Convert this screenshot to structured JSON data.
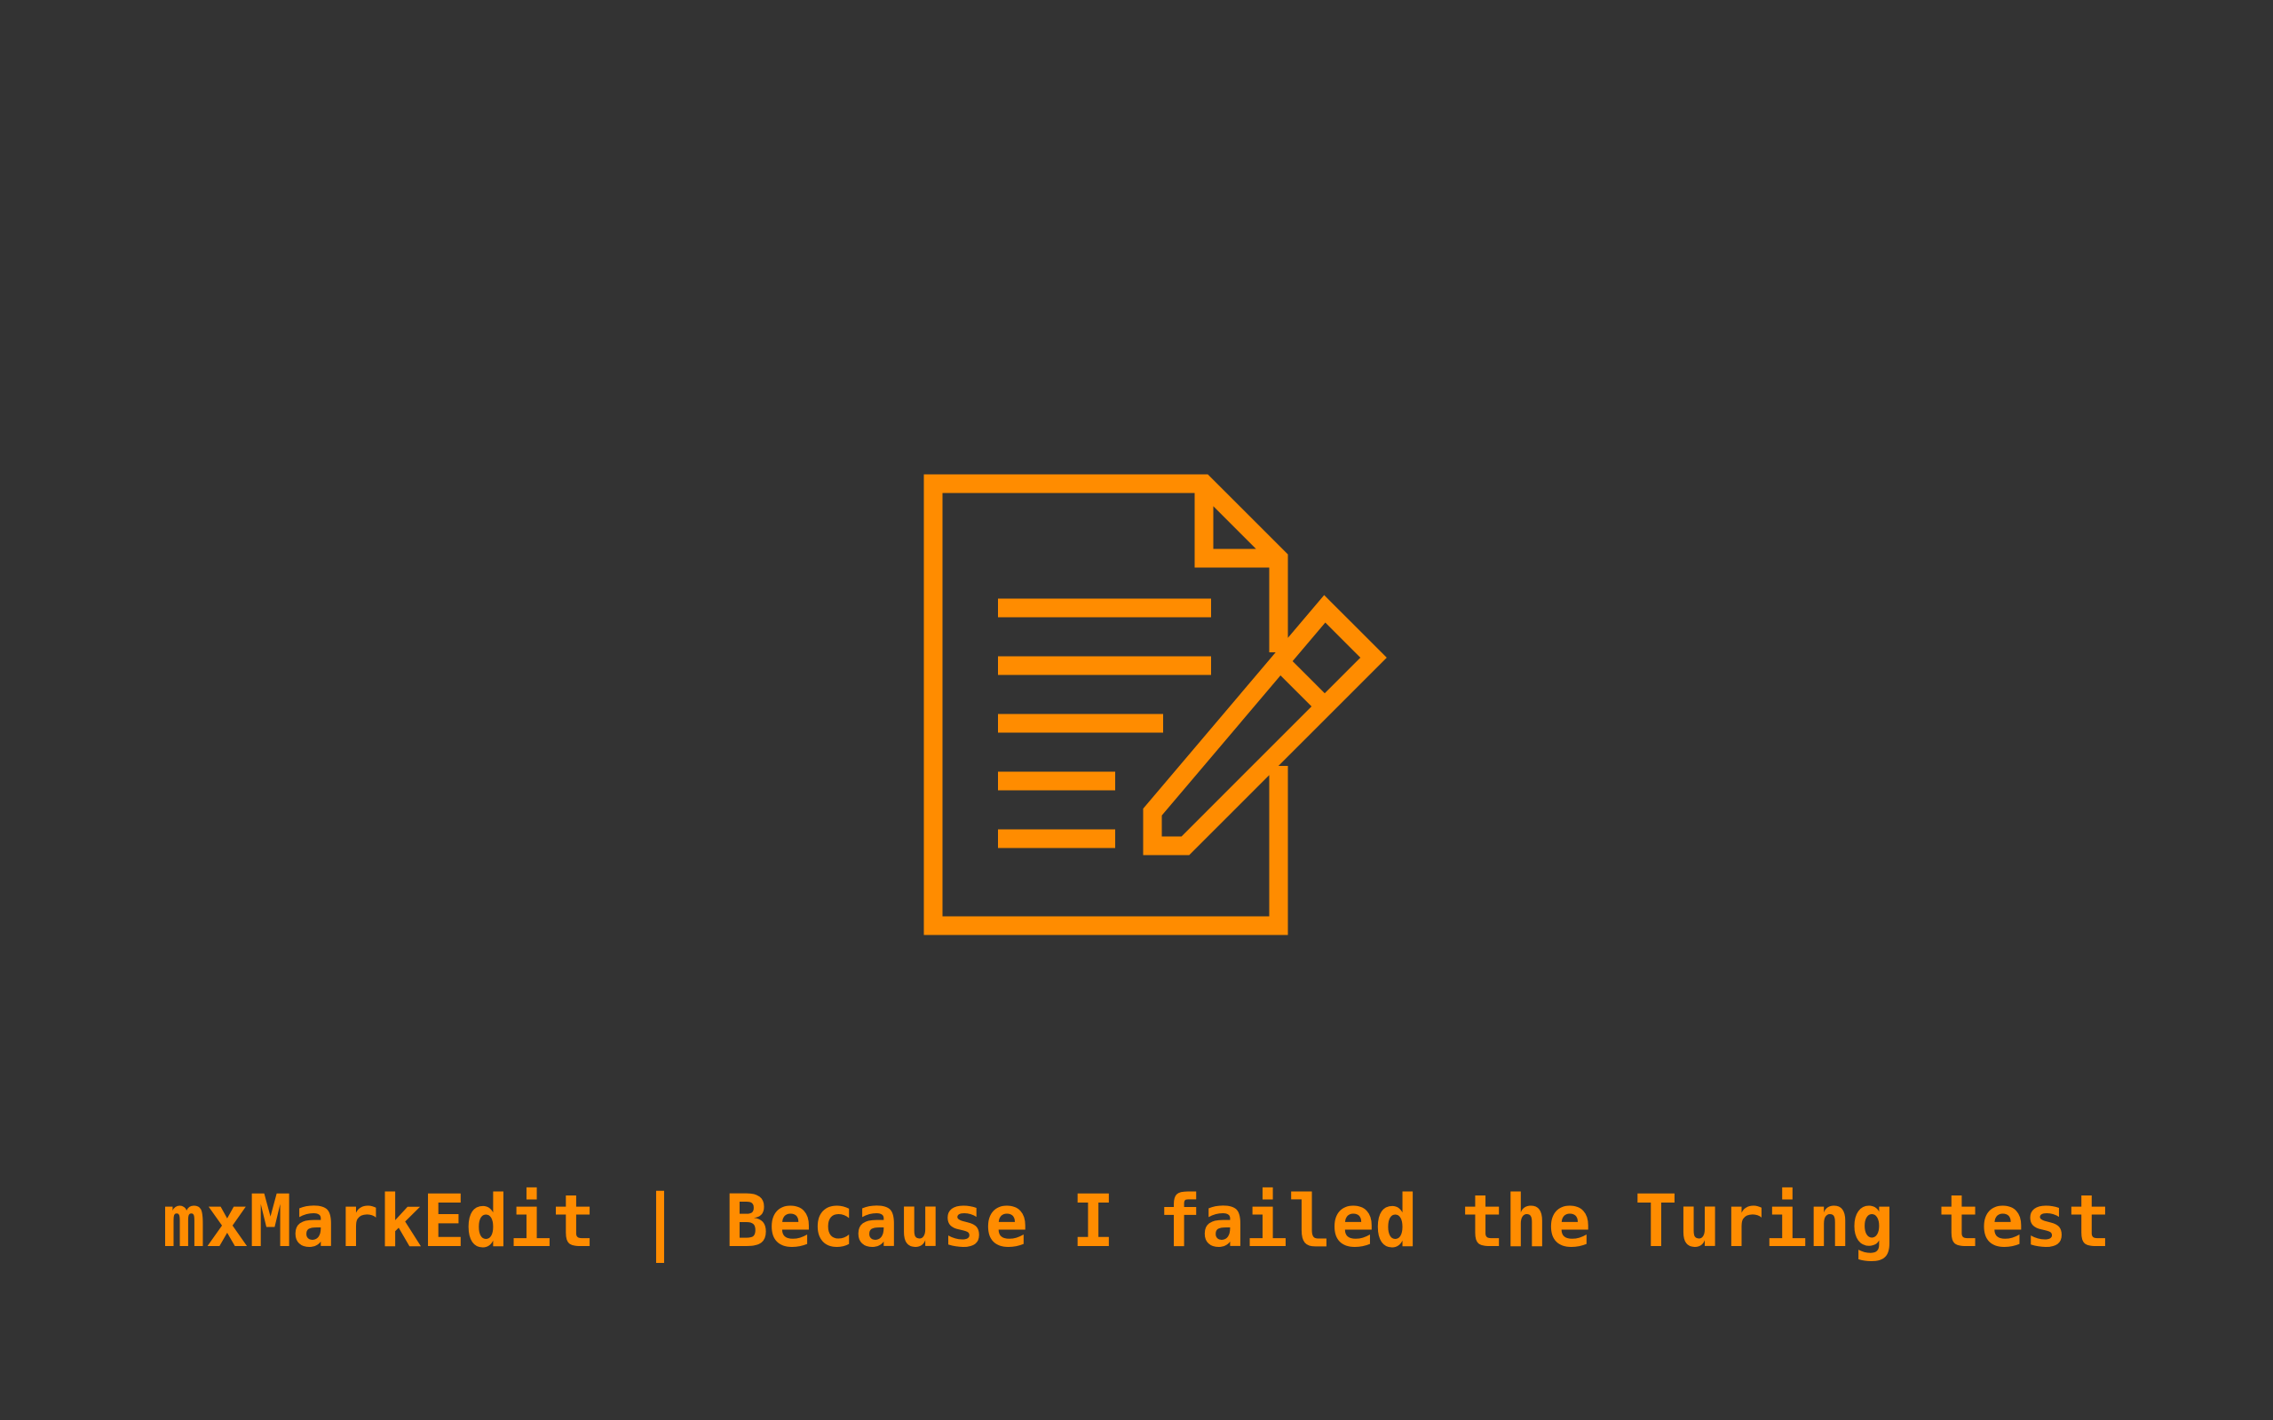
{
  "screen": {
    "tagline": "mxMarkEdit | Because I failed the Turing test",
    "icon": "document-edit-icon"
  },
  "colors": {
    "background": "#333333",
    "accent": "#ff8c00"
  }
}
